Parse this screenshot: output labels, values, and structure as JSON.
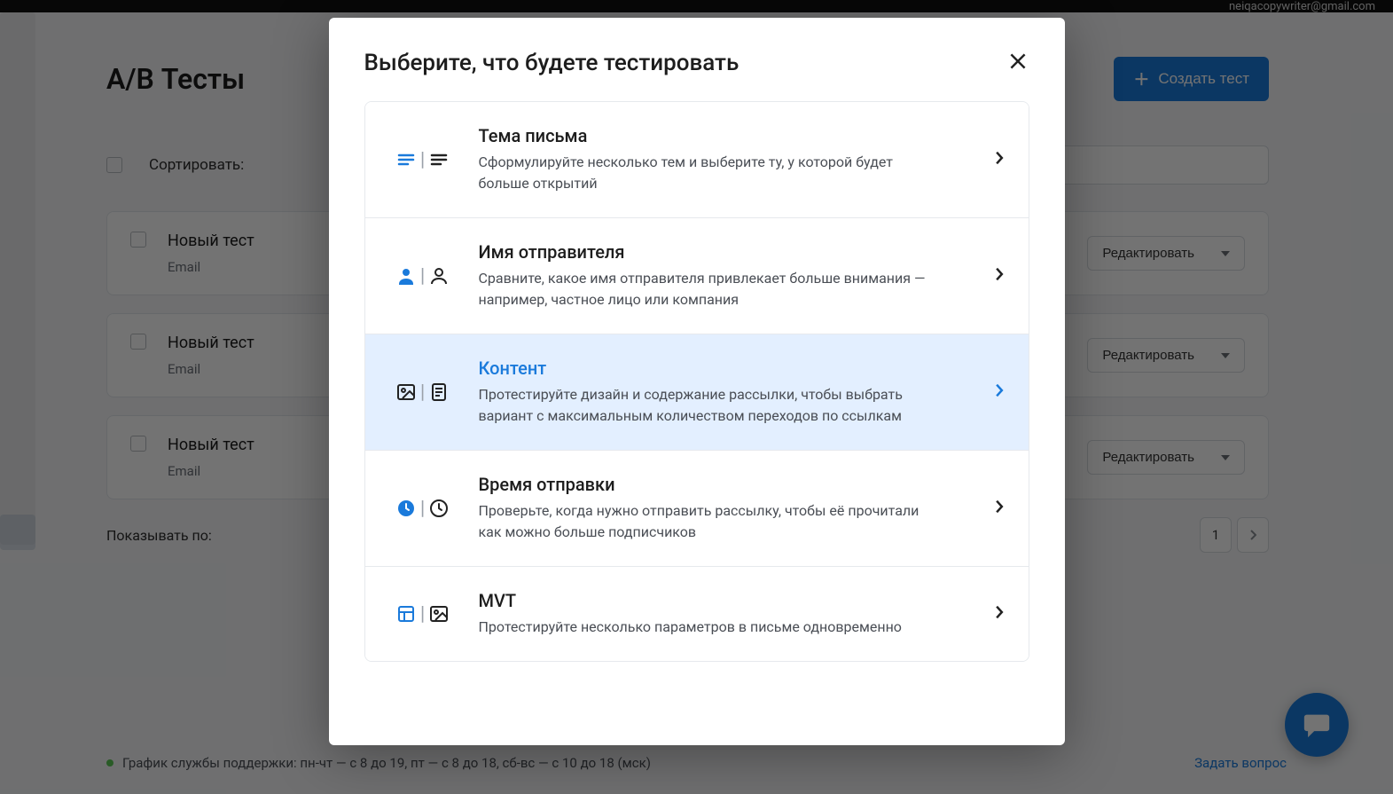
{
  "topbar": {
    "email": "neiqacopywriter@gmail.com"
  },
  "page": {
    "title": "A/B Тесты",
    "create_btn": "Создать тест",
    "sort_label": "Сортировать:",
    "search_placeholder": "",
    "show_per_page": "Показывать по:",
    "page_number": "1"
  },
  "tests": [
    {
      "title": "Новый тест",
      "sub": "Email",
      "edit": "Редактировать"
    },
    {
      "title": "Новый тест",
      "sub": "Email",
      "edit": "Редактировать"
    },
    {
      "title": "Новый тест",
      "sub": "Email",
      "edit": "Редактировать"
    }
  ],
  "footer": {
    "schedule": "График службы поддержки: пн-чт — с 8 до 19, пт — с 8 до 18, сб-вс — с 10 до 18 (мск)",
    "ask": "Задать вопрос"
  },
  "modal": {
    "title": "Выберите, что будете тестировать",
    "options": [
      {
        "key": "subject",
        "title": "Тема письма",
        "desc": "Сформулируйте несколько тем и выберите ту, у которой будет больше открытий",
        "active": false
      },
      {
        "key": "sender",
        "title": "Имя отправителя",
        "desc": "Сравните, какое имя отправителя привлекает больше внимания — например, частное лицо или компания",
        "active": false
      },
      {
        "key": "content",
        "title": "Контент",
        "desc": "Протестируйте дизайн и содержание рассылки, чтобы выбрать вариант с максимальным количеством переходов по ссылкам",
        "active": true
      },
      {
        "key": "time",
        "title": "Время отправки",
        "desc": "Проверьте, когда нужно отправить рассылку, чтобы её прочитали как можно больше подписчиков",
        "active": false
      },
      {
        "key": "mvt",
        "title": "MVT",
        "desc": "Протестируйте несколько параметров в письме одновременно",
        "active": false
      }
    ]
  }
}
